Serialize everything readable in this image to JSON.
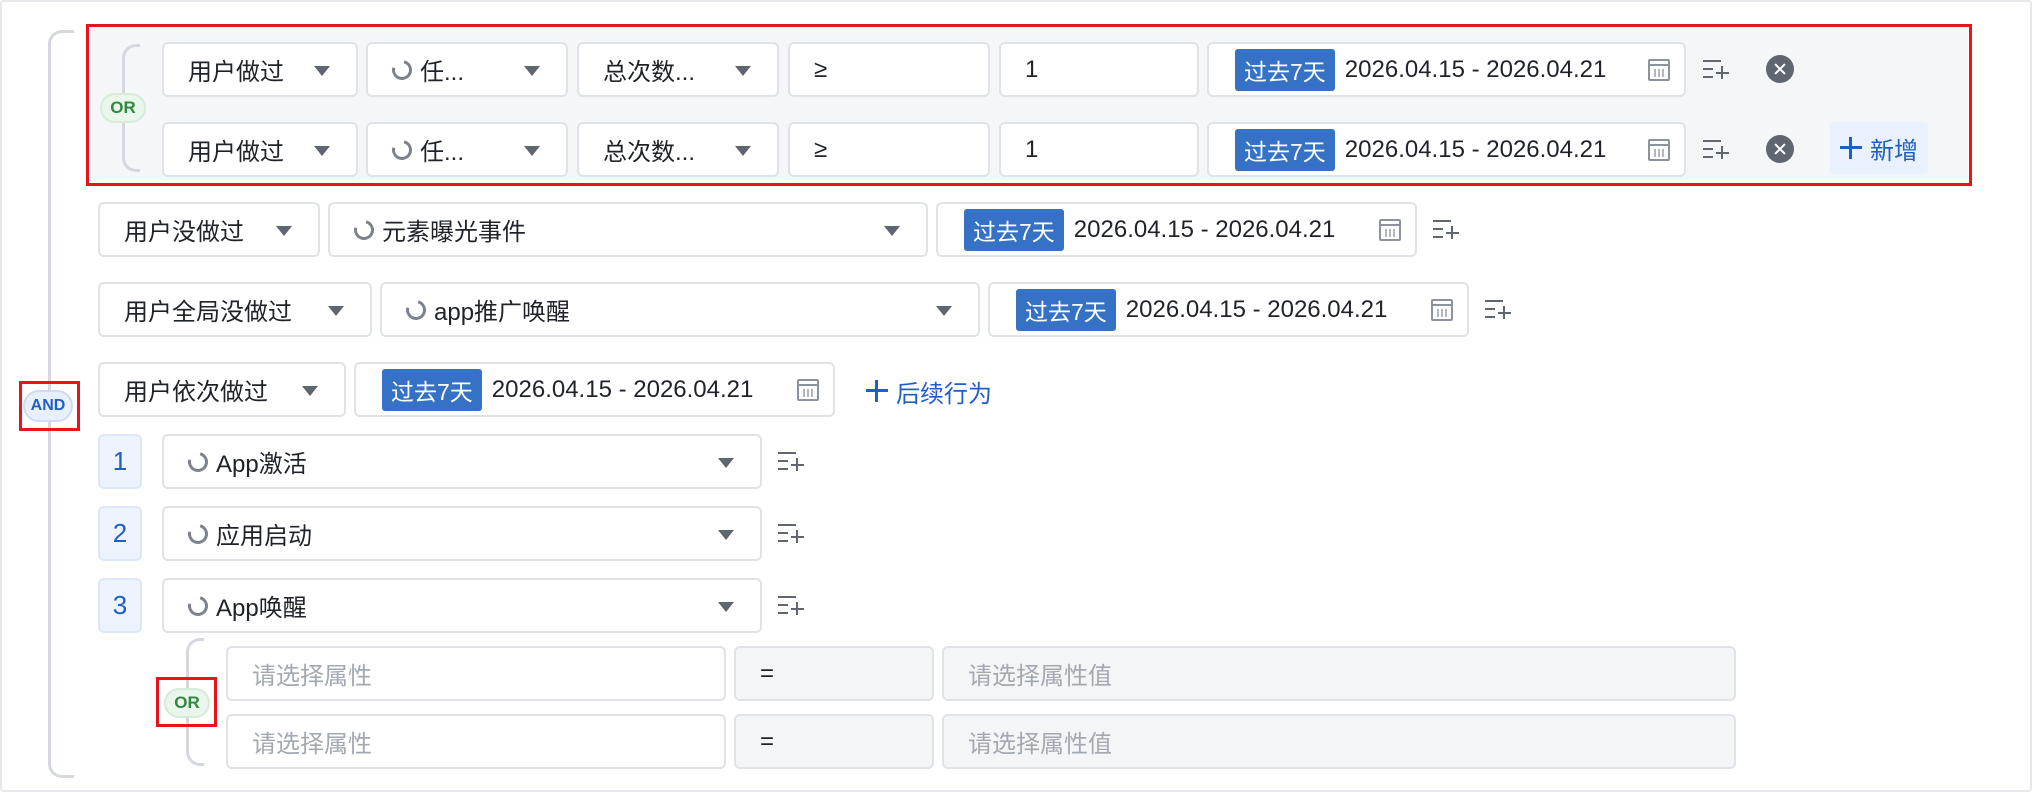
{
  "colors": {
    "accent": "#3572c6",
    "link": "#1f5fc4",
    "highlight_red": "#e8141c",
    "or_green": "#2f8a3f"
  },
  "logic": {
    "and_label": "AND",
    "or_label": "OR"
  },
  "date": {
    "tag": "过去7天",
    "range": "2026.04.15 - 2026.04.21"
  },
  "or_group": {
    "rows": [
      {
        "action": "用户做过",
        "event": "任...",
        "metric": "总次数...",
        "operator": "≥",
        "value": "1"
      },
      {
        "action": "用户做过",
        "event": "任...",
        "metric": "总次数...",
        "operator": "≥",
        "value": "1"
      }
    ],
    "add_label": "新增"
  },
  "row_not_done": {
    "action": "用户没做过",
    "event": "元素曝光事件"
  },
  "row_global_not_done": {
    "action": "用户全局没做过",
    "event": "app推广唤醒"
  },
  "row_sequence": {
    "action": "用户依次做过",
    "follow_label": "后续行为",
    "steps": [
      {
        "num": "1",
        "event": "App激活"
      },
      {
        "num": "2",
        "event": "应用启动"
      },
      {
        "num": "3",
        "event": "App唤醒"
      }
    ]
  },
  "property_filters": [
    {
      "property_placeholder": "请选择属性",
      "operator": "=",
      "value_placeholder": "请选择属性值"
    },
    {
      "property_placeholder": "请选择属性",
      "operator": "=",
      "value_placeholder": "请选择属性值"
    }
  ],
  "icons": {
    "dropdown": "chevron-down-icon",
    "search": "search-icon",
    "calendar": "calendar-icon",
    "add_filter": "list-plus-icon",
    "remove": "close-circle-icon",
    "add": "plus-icon"
  }
}
